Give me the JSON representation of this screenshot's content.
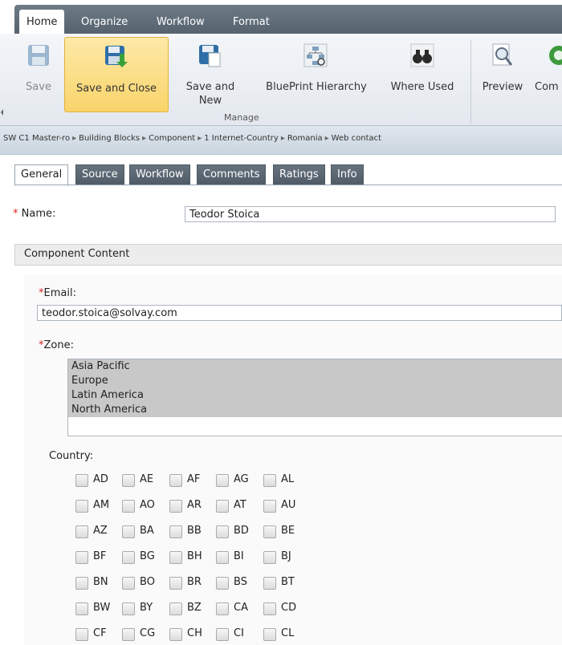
{
  "ribbon": {
    "tabs": [
      {
        "label": "Home"
      },
      {
        "label": "Organize"
      },
      {
        "label": "Workflow"
      },
      {
        "label": "Format"
      }
    ],
    "buttons": {
      "save": "Save",
      "save_close": "Save and Close",
      "save_new": "Save and\nNew",
      "blueprint": "BluePrint Hierarchy",
      "where_used": "Where Used",
      "preview": "Preview",
      "partial": "Com"
    },
    "group_manage": "Manage"
  },
  "breadcrumb": [
    "SW C1 Master-ro",
    "Building Blocks",
    "Component",
    "1 Internet-Country",
    "Romania",
    "Web contact"
  ],
  "content_tabs": [
    "General",
    "Source",
    "Workflow",
    "Comments",
    "Ratings",
    "Info"
  ],
  "form": {
    "name_label": "Name:",
    "name_value": "Teodor Stoica",
    "section_title": "Component Content",
    "email_label": "Email:",
    "email_value": "teodor.stoica@solvay.com",
    "zone_label": "Zone:",
    "zones": [
      "Asia Pacific",
      "Europe",
      "Latin America",
      "North America"
    ],
    "country_label": "Country:",
    "countries": [
      [
        "AD",
        "AE",
        "AF",
        "AG",
        "AL"
      ],
      [
        "AM",
        "AO",
        "AR",
        "AT",
        "AU"
      ],
      [
        "AZ",
        "BA",
        "BB",
        "BD",
        "BE"
      ],
      [
        "BF",
        "BG",
        "BH",
        "BI",
        "BJ"
      ],
      [
        "BN",
        "BO",
        "BR",
        "BS",
        "BT"
      ],
      [
        "BW",
        "BY",
        "BZ",
        "CA",
        "CD"
      ],
      [
        "CF",
        "CG",
        "CH",
        "CI",
        "CL"
      ]
    ]
  },
  "colors": {
    "tab_dark": "#5f6b77",
    "highlight": "#f9d46a",
    "required": "#dd2222"
  }
}
